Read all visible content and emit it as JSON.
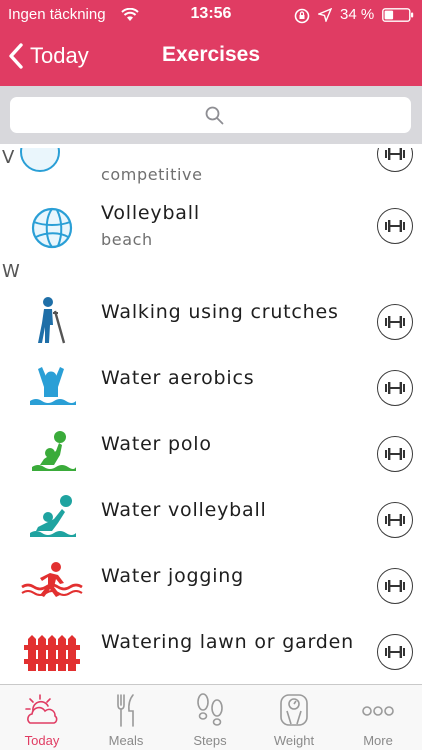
{
  "status_bar": {
    "carrier": "Ingen täckning",
    "time": "13:56",
    "battery": "34 %"
  },
  "nav": {
    "back_label": "Today",
    "title": "Exercises"
  },
  "search": {
    "placeholder": ""
  },
  "sections": [
    {
      "letter": "V",
      "items": [
        {
          "name": "",
          "sub": "competitive",
          "icon": "volleyball-icon"
        },
        {
          "name": "Volleyball",
          "sub": "beach",
          "icon": "volleyball-icon"
        }
      ]
    },
    {
      "letter": "W",
      "items": [
        {
          "name": "Walking using crutches",
          "icon": "crutches-walker-icon"
        },
        {
          "name": "Water aerobics",
          "icon": "water-aerobics-icon"
        },
        {
          "name": "Water polo",
          "icon": "water-polo-icon"
        },
        {
          "name": "Water volleyball",
          "icon": "water-volleyball-icon"
        },
        {
          "name": "Water jogging",
          "icon": "water-jogging-icon"
        },
        {
          "name": "Watering lawn or garden",
          "icon": "garden-fence-icon"
        }
      ]
    }
  ],
  "tabbar": {
    "items": [
      {
        "label": "Today",
        "icon": "sun-cloud-icon"
      },
      {
        "label": "Meals",
        "icon": "fork-knife-icon"
      },
      {
        "label": "Steps",
        "icon": "footprints-icon"
      },
      {
        "label": "Weight",
        "icon": "scale-icon"
      },
      {
        "label": "More",
        "icon": "ellipsis-icon"
      }
    ],
    "active": "Today"
  },
  "colors": {
    "accent": "#e03c63",
    "search_bg": "#d8d8dc"
  }
}
